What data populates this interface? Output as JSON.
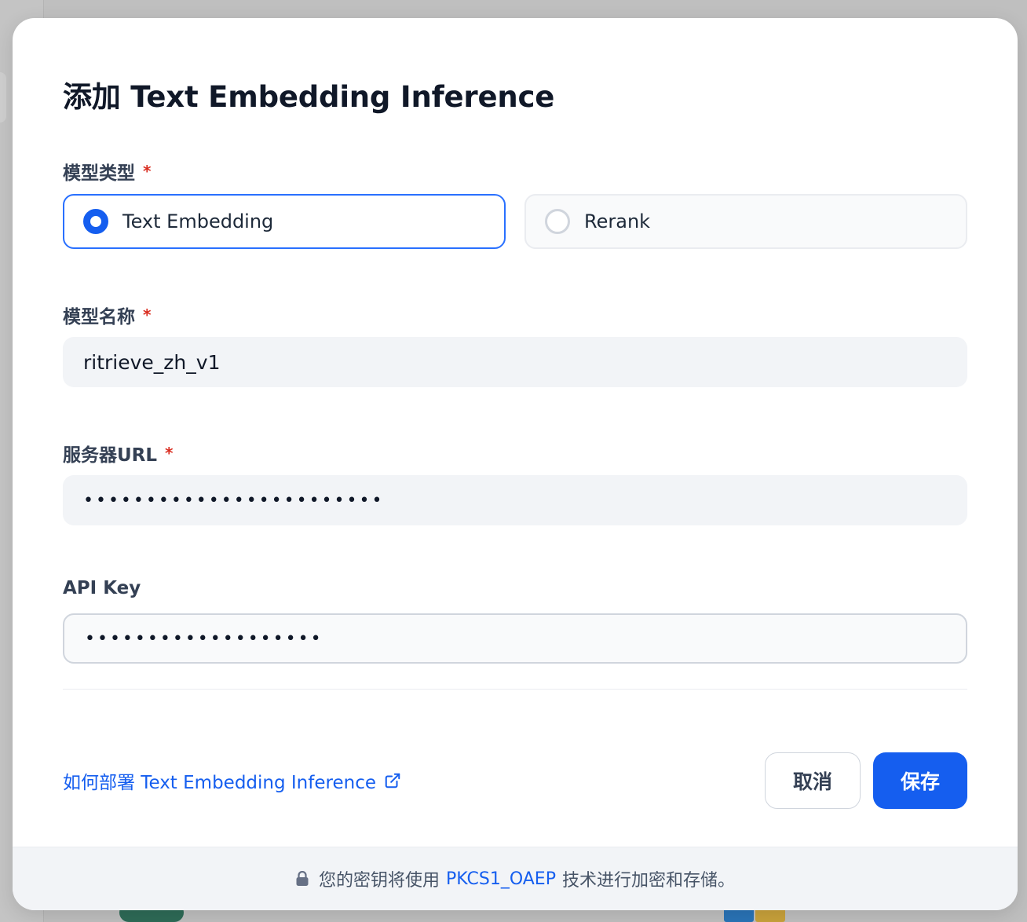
{
  "dialog": {
    "title": "添加 Text Embedding Inference",
    "model_type": {
      "label": "模型类型",
      "required_mark": "*",
      "options": [
        {
          "label": "Text Embedding",
          "selected": true
        },
        {
          "label": "Rerank",
          "selected": false
        }
      ]
    },
    "model_name": {
      "label": "模型名称",
      "required_mark": "*",
      "value": "ritrieve_zh_v1"
    },
    "server_url": {
      "label": "服务器URL",
      "required_mark": "*",
      "value": "••••••••••••••••••••••••"
    },
    "api_key": {
      "label": "API Key",
      "value": "•••••••••••••••••••"
    },
    "help_link": "如何部署 Text Embedding Inference",
    "buttons": {
      "cancel": "取消",
      "save": "保存"
    },
    "footer": {
      "prefix": "您的密钥将使用",
      "highlight": "PKCS1_OAEP",
      "suffix": "技术进行加密和存储。"
    }
  },
  "colors": {
    "primary": "#155eef",
    "required": "#d92d20"
  }
}
